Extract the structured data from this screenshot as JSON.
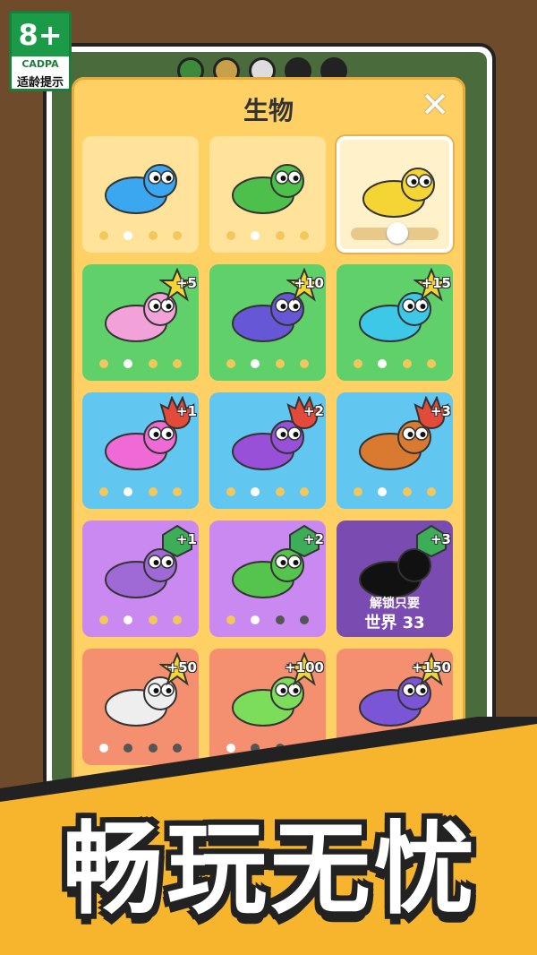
{
  "age_rating": {
    "label": "8+",
    "org": "CADPA",
    "caption": "适龄提示"
  },
  "panel": {
    "title": "生物",
    "close_symbol": "✕"
  },
  "cards": [
    {
      "color": "#ffe39b",
      "creature": "blue-cat-creature",
      "body": "#3aa7f0",
      "dots": [
        "d",
        "w",
        "d",
        "d"
      ],
      "badge": ""
    },
    {
      "color": "#ffe39b",
      "creature": "green-crab-creature",
      "body": "#4cc04a",
      "dots": [
        "d",
        "w",
        "d",
        "d"
      ],
      "badge": ""
    },
    {
      "color": "#fff1c9",
      "creature": "yellow-rex-creature",
      "body": "#f5d533",
      "selected": true,
      "slider": true,
      "badge": ""
    },
    {
      "color": "#5fd06a",
      "creature": "pink-gecko-creature",
      "body": "#f2a2d8",
      "dots": [
        "d",
        "w",
        "d",
        "d"
      ],
      "badge": "+5",
      "badge_kind": "star"
    },
    {
      "color": "#5fd06a",
      "creature": "purple-scorpion-creature",
      "body": "#6557d6",
      "dots": [
        "d",
        "w",
        "d",
        "d"
      ],
      "badge": "+10",
      "badge_kind": "star"
    },
    {
      "color": "#5fd06a",
      "creature": "cyan-spider-creature",
      "body": "#3cc8e6",
      "dots": [
        "d",
        "w",
        "d",
        "d"
      ],
      "badge": "+15",
      "badge_kind": "star"
    },
    {
      "color": "#61c6f0",
      "creature": "pink-cat-creature",
      "body": "#f06ad6",
      "dots": [
        "d",
        "w",
        "d",
        "d"
      ],
      "badge": "+1",
      "badge_kind": "paw"
    },
    {
      "color": "#61c6f0",
      "creature": "violet-scorpion-creature",
      "body": "#9950d8",
      "dots": [
        "d",
        "w",
        "d",
        "d"
      ],
      "badge": "+2",
      "badge_kind": "paw"
    },
    {
      "color": "#61c6f0",
      "creature": "orange-dino-creature",
      "body": "#d97a30",
      "dots": [
        "d",
        "w",
        "d",
        "d"
      ],
      "badge": "+3",
      "badge_kind": "paw"
    },
    {
      "color": "#c989f0",
      "creature": "purple-octopus-creature",
      "body": "#a06ad6",
      "dots": [
        "d",
        "w",
        "d",
        "d"
      ],
      "badge": "+1",
      "badge_kind": "gem"
    },
    {
      "color": "#c989f0",
      "creature": "green-snake-creature",
      "body": "#55c44d",
      "dots": [
        "d",
        "w",
        "g",
        "g"
      ],
      "badge": "+2",
      "badge_kind": "gem"
    },
    {
      "color": "#7a4bb0",
      "creature": "locked-silhouette",
      "body": "#111",
      "locked": true,
      "lock_line1": "解锁只要",
      "lock_line2": "世界 33",
      "badge": "+3",
      "badge_kind": "gem"
    },
    {
      "color": "#f48f6f",
      "creature": "white-larva-creature",
      "body": "#eeeeee",
      "dots": [
        "w",
        "g",
        "g",
        "g"
      ],
      "badge": "+50",
      "badge_kind": "star"
    },
    {
      "color": "#f48f6f",
      "creature": "green-worm-creature",
      "body": "#7bdd5a",
      "dots": [
        "w",
        "g",
        "g",
        "g"
      ],
      "badge": "+100",
      "badge_kind": "star"
    },
    {
      "color": "#f48f6f",
      "creature": "purple-eel-creature",
      "body": "#7a55d6",
      "dots": [
        "w",
        "g",
        "g",
        "g"
      ],
      "badge": "+150",
      "badge_kind": "star"
    }
  ],
  "slogan": "畅玩无忧"
}
